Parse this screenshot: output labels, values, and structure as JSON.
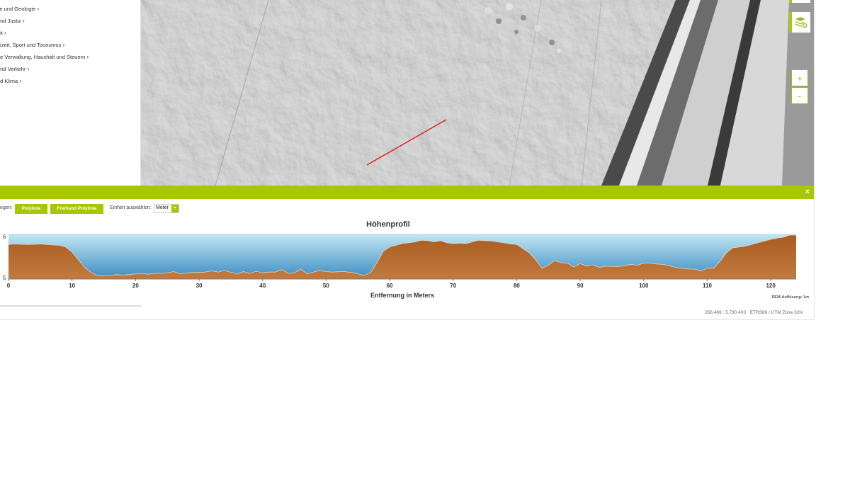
{
  "sidebar": {
    "items": [
      {
        "label": "ile und Geologie"
      },
      {
        "label": "und Justiz"
      },
      {
        "label": "eit"
      },
      {
        "label": "eizeit, Sport und Tourismus"
      },
      {
        "label": "he Verwaltung, Haushalt und Steuern"
      },
      {
        "label": " und Verkehr"
      },
      {
        "label": "nd Klima"
      }
    ]
  },
  "map": {
    "zoom_in": "+",
    "zoom_out": "-",
    "layers_icon": "layers-settings-icon"
  },
  "panel": {
    "close": "×",
    "draw_label": "egen:",
    "polyline_label": "Polylinie",
    "freehand_label": "Freihand Polylinie",
    "unit_label": "Einheit auswählen:",
    "unit_value": "Meter"
  },
  "chart_data": {
    "type": "area",
    "title": "Höhenprofil",
    "xlabel": "Entfernung in Meters",
    "ylabel": "",
    "xlim": [
      0,
      124
    ],
    "ylim": [
      0,
      1
    ],
    "x_ticks": [
      0,
      10,
      20,
      30,
      40,
      50,
      60,
      70,
      80,
      90,
      100,
      110,
      120
    ],
    "y_tick_labels": [
      "6",
      "5"
    ],
    "note": "DEM-Auflösung: 1m",
    "x": [
      0,
      1,
      3,
      5,
      7,
      8,
      9,
      10,
      11,
      12,
      13,
      14,
      15,
      16,
      17,
      18,
      19,
      20,
      21,
      22,
      23,
      24,
      25,
      26,
      27,
      28,
      29,
      30,
      31,
      32,
      33,
      34,
      35,
      36,
      37,
      38,
      39,
      40,
      41,
      42,
      43,
      44,
      45,
      46,
      47,
      48,
      49,
      50,
      51,
      52,
      53,
      54,
      55,
      56,
      57,
      58,
      59,
      60,
      61,
      62,
      63,
      64,
      65,
      66,
      67,
      68,
      69,
      70,
      71,
      72,
      73,
      74,
      75,
      76,
      77,
      78,
      79,
      80,
      81,
      82,
      83,
      84,
      85,
      86,
      87,
      88,
      89,
      90,
      91,
      92,
      93,
      94,
      95,
      96,
      97,
      98,
      99,
      100,
      101,
      102,
      103,
      104,
      105,
      106,
      107,
      108,
      109,
      110,
      111,
      112,
      113,
      114,
      115,
      116,
      117,
      118,
      119,
      120,
      121,
      122,
      123,
      124
    ],
    "y": [
      0.78,
      0.79,
      0.78,
      0.79,
      0.77,
      0.76,
      0.72,
      0.6,
      0.42,
      0.24,
      0.12,
      0.05,
      0.04,
      0.05,
      0.07,
      0.06,
      0.07,
      0.09,
      0.1,
      0.08,
      0.1,
      0.1,
      0.11,
      0.14,
      0.09,
      0.11,
      0.12,
      0.12,
      0.13,
      0.16,
      0.13,
      0.17,
      0.12,
      0.09,
      0.14,
      0.1,
      0.15,
      0.11,
      0.13,
      0.13,
      0.19,
      0.1,
      0.11,
      0.2,
      0.09,
      0.13,
      0.17,
      0.14,
      0.13,
      0.14,
      0.14,
      0.12,
      0.09,
      0.05,
      0.12,
      0.35,
      0.62,
      0.72,
      0.76,
      0.8,
      0.82,
      0.84,
      0.88,
      0.87,
      0.84,
      0.87,
      0.82,
      0.8,
      0.81,
      0.8,
      0.84,
      0.88,
      0.87,
      0.86,
      0.84,
      0.82,
      0.79,
      0.78,
      0.68,
      0.58,
      0.42,
      0.22,
      0.3,
      0.4,
      0.35,
      0.34,
      0.25,
      0.33,
      0.27,
      0.3,
      0.24,
      0.27,
      0.26,
      0.26,
      0.28,
      0.31,
      0.29,
      0.34,
      0.34,
      0.32,
      0.31,
      0.28,
      0.24,
      0.22,
      0.2,
      0.2,
      0.16,
      0.22,
      0.22,
      0.38,
      0.58,
      0.7,
      0.72,
      0.74,
      0.78,
      0.82,
      0.86,
      0.9,
      0.93,
      0.95,
      1.0,
      1.0,
      1.0
    ]
  },
  "footer": {
    "coords": "356.469 : 5.730.403",
    "crs": "ETRS89 / UTM Zone 32N"
  },
  "colors": {
    "accent": "#a8c700",
    "terrain": "#b0642a",
    "sky_top": "#bfe6f2",
    "sky_bottom": "#3f8fc4",
    "measure_line": "#e01b1b"
  }
}
